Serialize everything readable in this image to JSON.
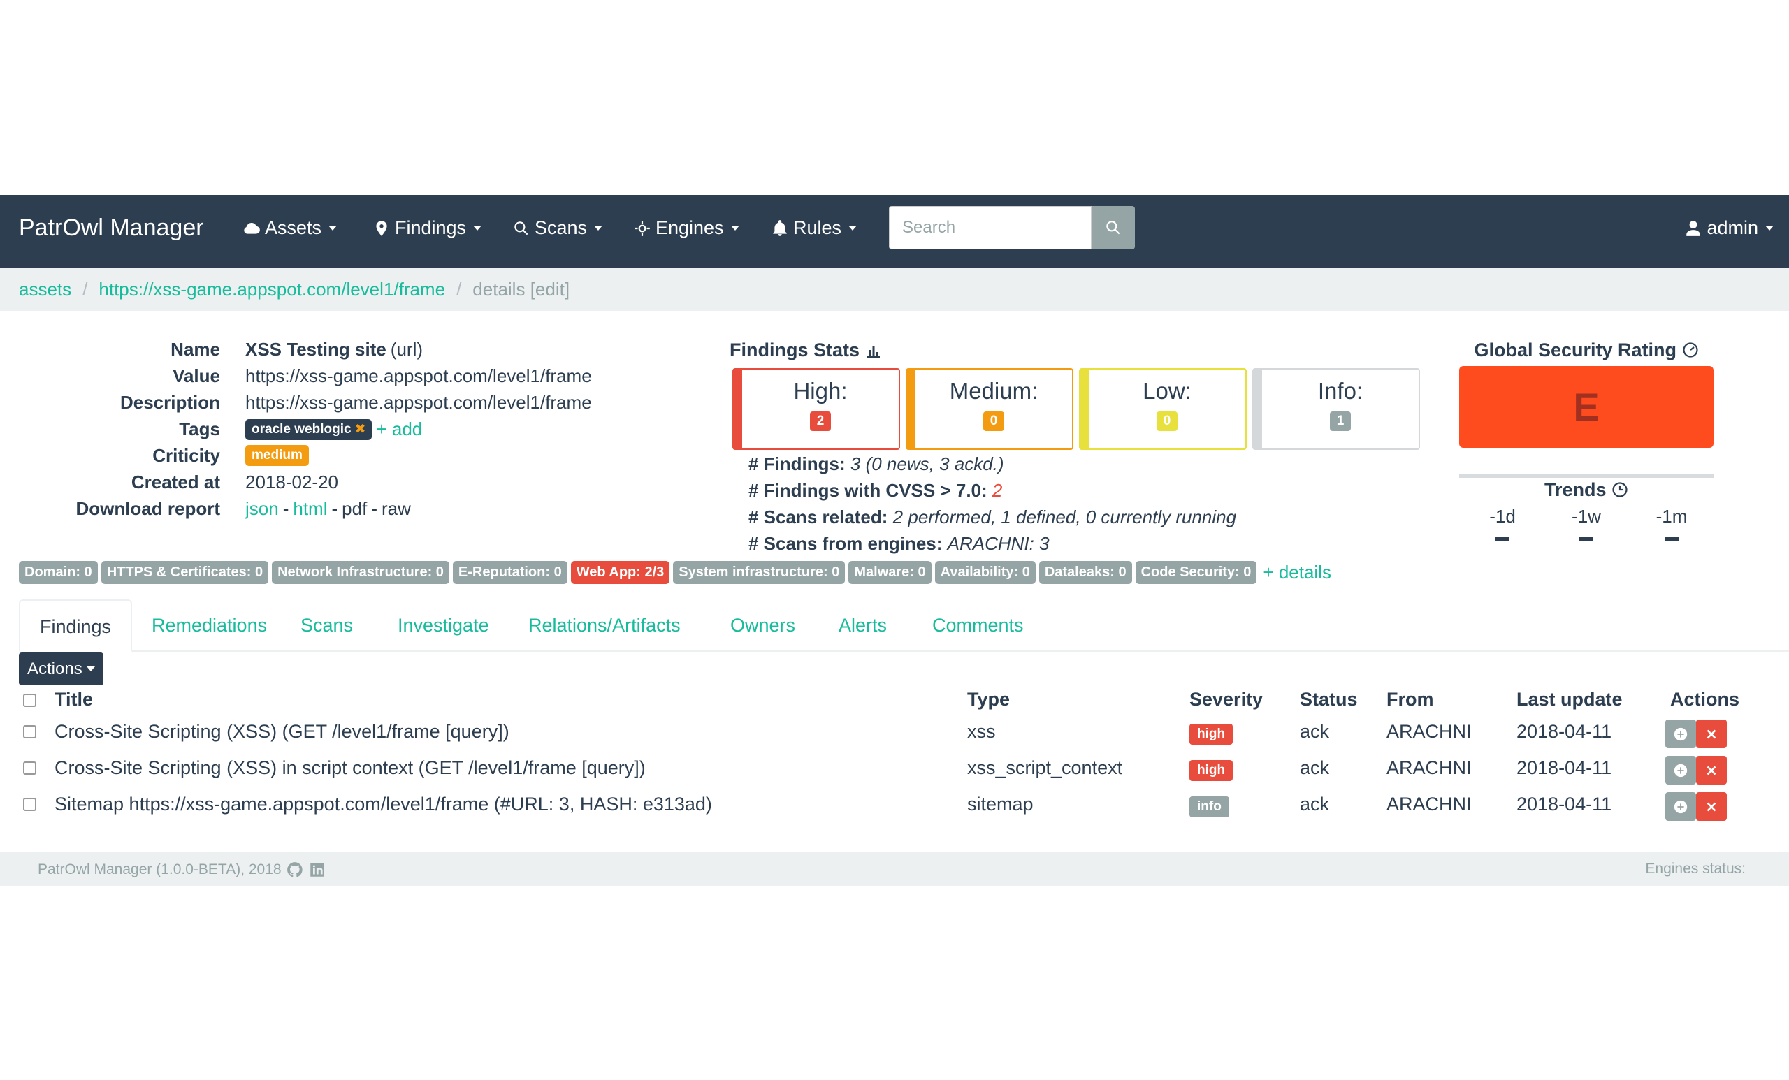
{
  "navbar": {
    "brand": "PatrOwl Manager",
    "items": [
      {
        "label": "Assets",
        "icon": "cloud-icon"
      },
      {
        "label": "Findings",
        "icon": "map-marker-icon"
      },
      {
        "label": "Scans",
        "icon": "search-icon"
      },
      {
        "label": "Engines",
        "icon": "crosshair-icon"
      },
      {
        "label": "Rules",
        "icon": "bell-icon"
      }
    ],
    "search_placeholder": "Search",
    "user": "admin"
  },
  "breadcrumb": {
    "root": "assets",
    "asset": "https://xss-game.appspot.com/level1/frame",
    "current": "details",
    "edit": "[edit]"
  },
  "asset": {
    "labels": {
      "name": "Name",
      "value": "Value",
      "description": "Description",
      "tags": "Tags",
      "criticity": "Criticity",
      "created_at": "Created at",
      "download_report": "Download report"
    },
    "name": "XSS Testing site",
    "name_type": "(url)",
    "value": "https://xss-game.appspot.com/level1/frame",
    "description": "https://xss-game.appspot.com/level1/frame",
    "tag": "oracle weblogic",
    "tag_remove": "✖",
    "tag_add": "+ add",
    "criticity": "medium",
    "created_at": "2018-02-20",
    "reports": {
      "json": "json",
      "html": "html",
      "pdf": "pdf",
      "raw": "raw",
      "sep": "-"
    }
  },
  "findings_stats": {
    "title": "Findings Stats",
    "boxes": [
      {
        "label": "High:",
        "count": "2",
        "color": "#e74c3c"
      },
      {
        "label": "Medium:",
        "count": "0",
        "color": "#f39c12"
      },
      {
        "label": "Low:",
        "count": "0",
        "color": "#e8e03c"
      },
      {
        "label": "Info:",
        "count": "1",
        "color": "#95a5a6"
      }
    ],
    "lines": [
      {
        "label": "# Findings:",
        "value": "3 (0 news, 3 ackd.)"
      },
      {
        "label": "# Findings with CVSS > 7.0:",
        "value": "2"
      },
      {
        "label": "# Scans related:",
        "value": "2 performed, 1 defined, 0 currently running"
      },
      {
        "label": "# Scans from engines:",
        "value": "ARACHNI: 3"
      }
    ]
  },
  "rating": {
    "title": "Global Security Rating",
    "grade": "E",
    "trends_title": "Trends",
    "trends": [
      {
        "label": "-1d"
      },
      {
        "label": "-1w"
      },
      {
        "label": "-1m"
      }
    ]
  },
  "categories": [
    {
      "label": "Domain: 0",
      "color": "#95a5a6"
    },
    {
      "label": "HTTPS & Certificates: 0",
      "color": "#95a5a6"
    },
    {
      "label": "Network Infrastructure: 0",
      "color": "#95a5a6"
    },
    {
      "label": "E-Reputation: 0",
      "color": "#95a5a6"
    },
    {
      "label": "Web App: 2/3",
      "color": "#e74c3c"
    },
    {
      "label": "System infrastructure: 0",
      "color": "#95a5a6"
    },
    {
      "label": "Malware: 0",
      "color": "#95a5a6"
    },
    {
      "label": "Availability: 0",
      "color": "#95a5a6"
    },
    {
      "label": "Dataleaks: 0",
      "color": "#95a5a6"
    },
    {
      "label": "Code Security: 0",
      "color": "#95a5a6"
    }
  ],
  "categories_more": "+ details",
  "tabs": [
    "Findings",
    "Remediations",
    "Scans",
    "Investigate",
    "Relations/Artifacts",
    "Owners",
    "Alerts",
    "Comments"
  ],
  "actions_label": "Actions",
  "table": {
    "headers": {
      "title": "Title",
      "type": "Type",
      "severity": "Severity",
      "status": "Status",
      "from": "From",
      "last_update": "Last update",
      "actions": "Actions"
    },
    "rows": [
      {
        "title": "Cross-Site Scripting (XSS) (GET /level1/frame [query])",
        "type": "xss",
        "severity": "high",
        "status": "ack",
        "from": "ARACHNI",
        "last_update": "2018-04-11"
      },
      {
        "title": "Cross-Site Scripting (XSS) in script context (GET /level1/frame [query])",
        "type": "xss_script_context",
        "severity": "high",
        "status": "ack",
        "from": "ARACHNI",
        "last_update": "2018-04-11"
      },
      {
        "title": "Sitemap https://xss-game.appspot.com/level1/frame (#URL: 3, HASH: e313ad)",
        "type": "sitemap",
        "severity": "info",
        "status": "ack",
        "from": "ARACHNI",
        "last_update": "2018-04-11"
      }
    ]
  },
  "footer": {
    "left": "PatrOwl Manager (1.0.0-BETA), 2018",
    "right": "Engines status:"
  }
}
